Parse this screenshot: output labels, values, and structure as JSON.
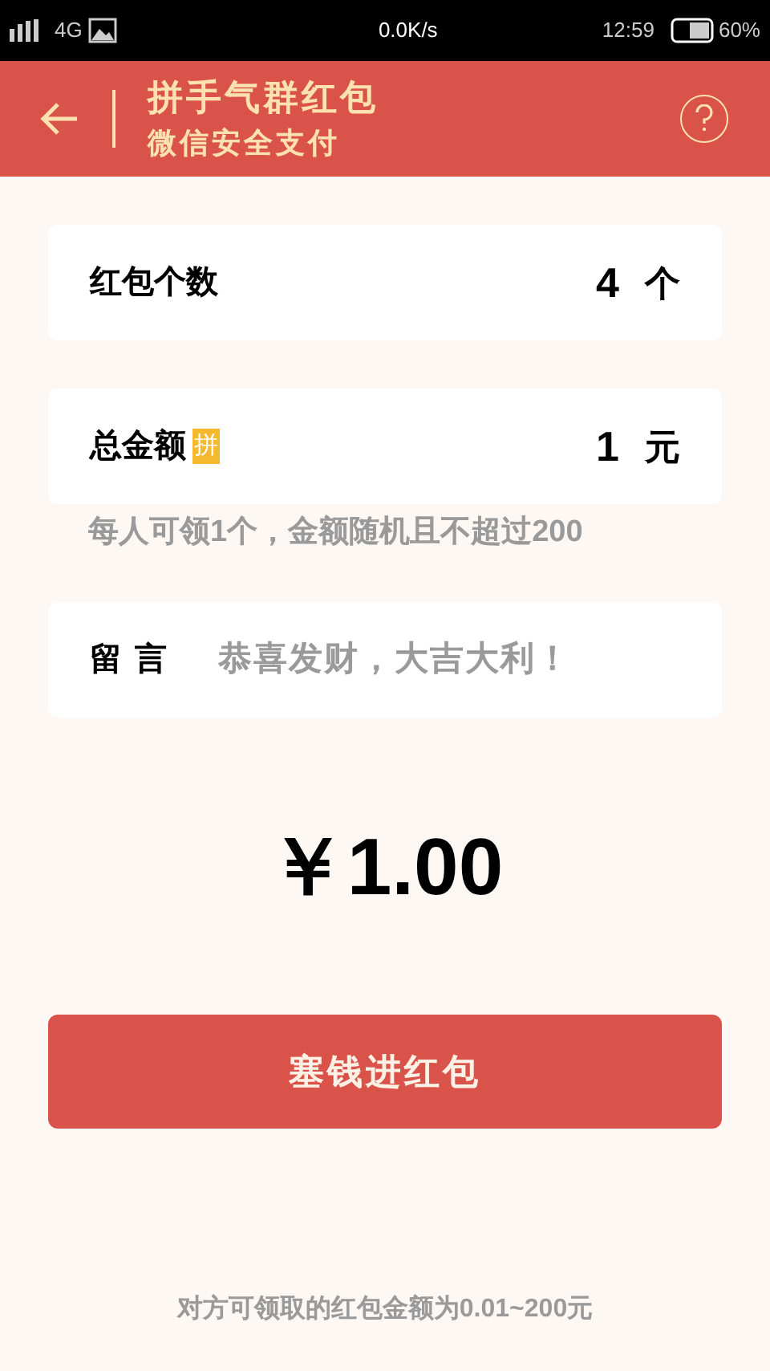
{
  "status_bar": {
    "network": "4G",
    "speed": "0.0K/s",
    "time": "12:59",
    "battery": "60%"
  },
  "header": {
    "title": "拼手气群红包",
    "subtitle": "微信安全支付"
  },
  "count_row": {
    "label": "红包个数",
    "value": "4",
    "unit": "个"
  },
  "amount_row": {
    "label": "总金额",
    "badge": "拼",
    "value": "1",
    "unit": "元"
  },
  "hint": "每人可领1个，金额随机且不超过200",
  "message_row": {
    "label": "留言",
    "placeholder": "恭喜发财，大吉大利！"
  },
  "total": "￥1.00",
  "submit_button": "塞钱进红包",
  "footer": "对方可领取的红包金额为0.01~200元"
}
